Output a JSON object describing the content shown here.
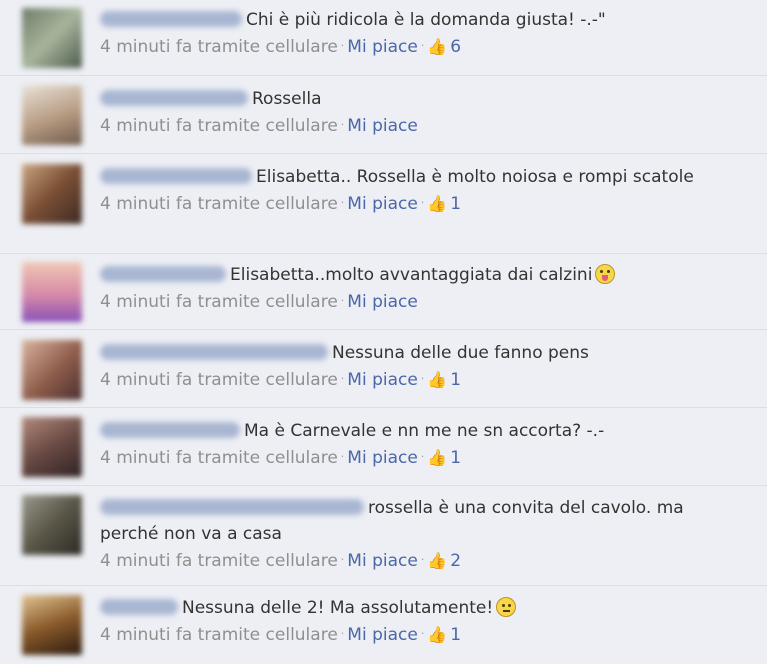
{
  "meta": {
    "time": "4 minuti fa tramite cellulare",
    "like_label": "Mi piace",
    "separator": "·",
    "thumb_icon": "thumbs-up-icon"
  },
  "comments": [
    {
      "text": "Chi è più ridicola è la domanda giusta! -.-\"",
      "likes": "6"
    },
    {
      "text": "Rossella",
      "likes": ""
    },
    {
      "text": "Elisabetta.. Rossella è molto noiosa e rompi scatole",
      "likes": "1"
    },
    {
      "text": "Elisabetta..molto avvantaggiata dai calzini",
      "likes": "",
      "emoji": "tongue-emoticon-icon"
    },
    {
      "text": "Nessuna delle due fanno pens",
      "likes": "1"
    },
    {
      "text": "Ma è Carnevale e nn me ne sn accorta? -.-",
      "likes": "1"
    },
    {
      "text": "rossella è una convita del cavolo. ma perché non va a casa",
      "likes": "2"
    },
    {
      "text": "Nessuna delle 2! Ma assolutamente!",
      "likes": "1",
      "emoji": "neutral-emoticon-icon"
    }
  ],
  "colors": {
    "background": "#edeff4",
    "link": "#4a67a8",
    "meta": "#8f8f8f"
  }
}
